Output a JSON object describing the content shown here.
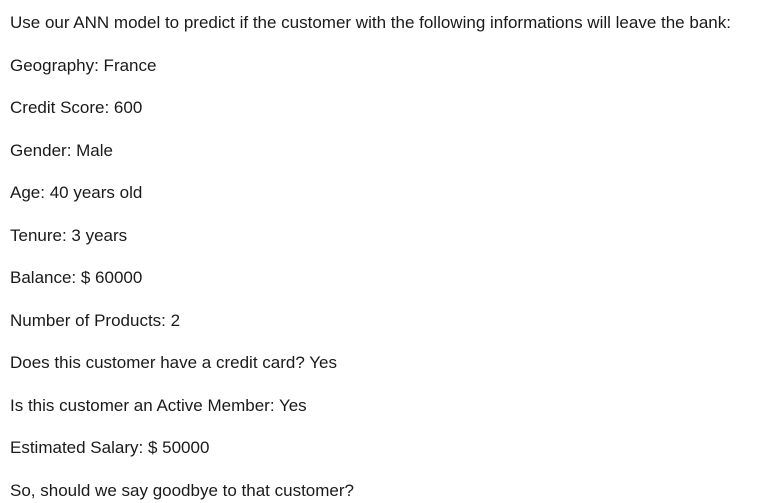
{
  "document": {
    "intro": "Use our ANN model to predict if the customer with the following informations will leave the bank:",
    "fields": [
      "Geography: France",
      "Credit Score: 600",
      "Gender: Male",
      "Age: 40 years old",
      "Tenure: 3 years",
      "Balance: $ 60000",
      "Number of Products: 2",
      "Does this customer have a credit card? Yes",
      "Is this customer an Active Member: Yes",
      "Estimated Salary: $ 50000"
    ],
    "question": "So, should we say goodbye to that customer?"
  }
}
